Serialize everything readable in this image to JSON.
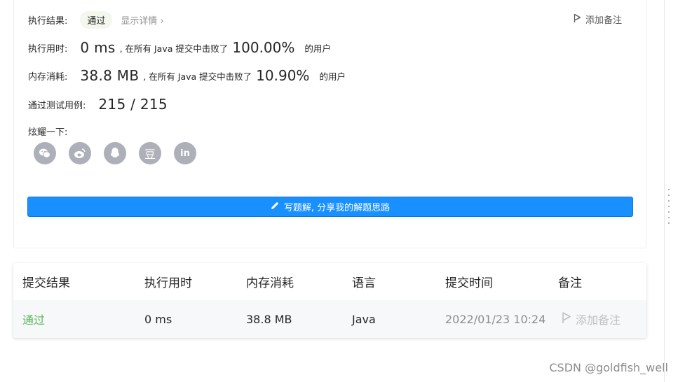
{
  "result": {
    "label": "执行结果:",
    "status": "通过",
    "details_link": "显示详情 ›",
    "add_note": "添加备注"
  },
  "runtime": {
    "label": "执行用时:",
    "value": "0 ms",
    "mid_text": ", 在所有 Java 提交中击败了",
    "percent": "100.00%",
    "suffix": "的用户"
  },
  "memory": {
    "label": "内存消耗:",
    "value": "38.8 MB",
    "mid_text": ", 在所有 Java 提交中击败了",
    "percent": "10.90%",
    "suffix": "的用户"
  },
  "testcases": {
    "label": "通过测试用例:",
    "value": "215 / 215"
  },
  "share": {
    "label": "炫耀一下:",
    "icons": [
      "wechat-icon",
      "weibo-icon",
      "qq-icon",
      "douban-icon",
      "linkedin-icon"
    ],
    "douban_glyph": "豆",
    "linkedin_glyph": "in"
  },
  "write_solution_label": "写题解, 分享我的解题思路",
  "table": {
    "headers": [
      "提交结果",
      "执行用时",
      "内存消耗",
      "语言",
      "提交时间",
      "备注"
    ],
    "row": {
      "result": "通过",
      "runtime": "0 ms",
      "memory": "38.8 MB",
      "language": "Java",
      "time": "2022/01/23 10:24",
      "note": "添加备注"
    }
  },
  "colors": {
    "primary": "#1890ff",
    "pass_green": "#5cb85c",
    "icon_gray": "#adb0b8"
  },
  "watermark": "CSDN @goldfish_well"
}
